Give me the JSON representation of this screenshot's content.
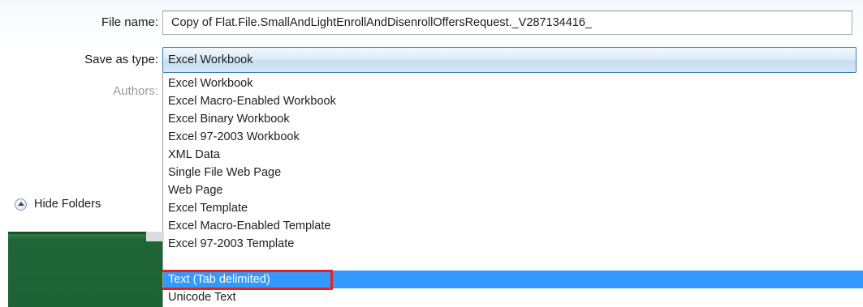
{
  "file_name": {
    "label": "File name:",
    "value": "Copy of Flat.File.SmallAndLightEnrollAndDisenrollOffersRequest._V287134416_"
  },
  "save_as_type": {
    "label": "Save as type:",
    "selected": "Excel Workbook"
  },
  "authors": {
    "label": "Authors:"
  },
  "hide_folders": {
    "label": "Hide Folders",
    "icon": "chevron-up-circle-icon"
  },
  "type_options": [
    "Excel Workbook",
    "Excel Macro-Enabled Workbook",
    "Excel Binary Workbook",
    "Excel 97-2003 Workbook",
    "XML Data",
    "Single File Web Page",
    "Web Page",
    "Excel Template",
    "Excel Macro-Enabled Template",
    "Excel 97-2003 Template",
    "Text (Tab delimited)",
    "Unicode Text"
  ],
  "highlighted_option": "Text (Tab delimited)",
  "colors": {
    "selection": "#3399ff",
    "highlight_box": "#e8201f",
    "excel_green": "#1d6235"
  }
}
